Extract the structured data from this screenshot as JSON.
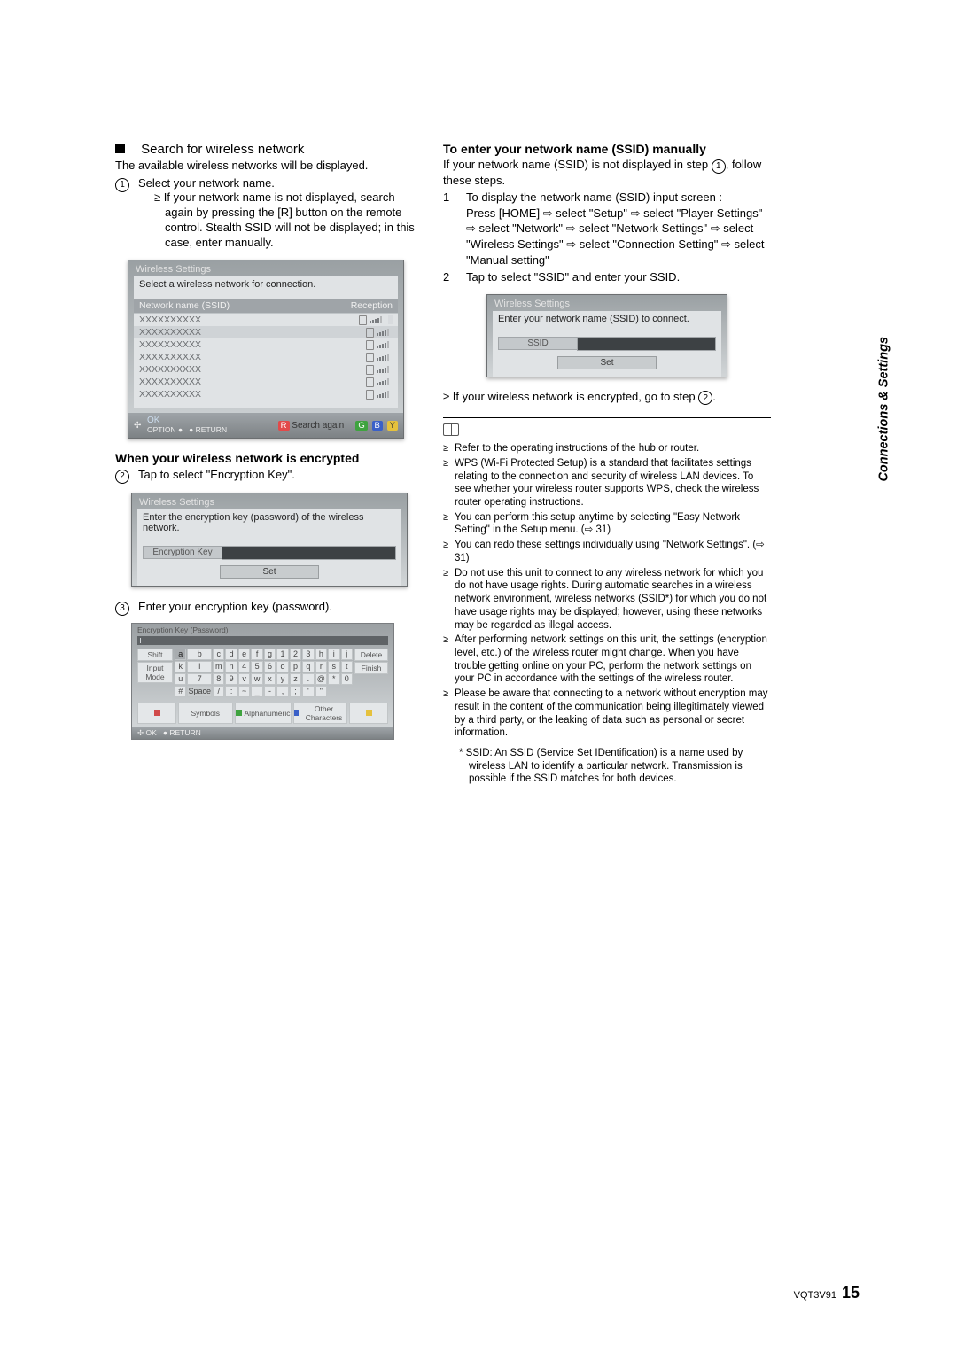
{
  "left": {
    "heading": "Search for wireless network",
    "intro": "The available wireless networks will be displayed.",
    "step1_label": "1",
    "step1_text": "Select your network name.",
    "step1_bullet": "If your network name is not displayed, search again by pressing the [R] button on the remote control. Stealth SSID will not be displayed; in this case, enter manually.",
    "panel_net": {
      "title": "Wireless Settings",
      "prompt": "Select a wireless network for connection.",
      "col_a": "Network name (SSID)",
      "col_b": "Reception",
      "ssid": "XXXXXXXXXX",
      "footer_ok": "OK",
      "footer_option": "OPTION",
      "footer_return": "RETURN",
      "footer_search": "Search again",
      "r": "R",
      "g": "G",
      "b": "B",
      "y": "Y"
    },
    "encrypted_heading": "When your wireless network is encrypted",
    "step2_label": "2",
    "step2_text": "Tap to select \"Encryption Key\".",
    "panel_ek": {
      "title": "Wireless Settings",
      "prompt": "Enter the encryption key (password) of the wireless network.",
      "label": "Encryption Key",
      "set": "Set"
    },
    "step3_label": "3",
    "step3_text": "Enter your encryption key (password).",
    "kb": {
      "title": "Encryption Key (Password)",
      "shift": "Shift",
      "inputmode": "Input Mode",
      "delete": "Delete",
      "finish": "Finish",
      "space": "Space",
      "symbols": "Symbols",
      "alpha": "Alphanumeric",
      "other": "Other Characters",
      "ok": "OK",
      "return": "RETURN",
      "keys": [
        "a",
        "b",
        "c",
        "d",
        "e",
        "f",
        "g",
        "1",
        "2",
        "3",
        "h",
        "i",
        "j",
        "k",
        "l",
        "m",
        "n",
        "4",
        "5",
        "6",
        "o",
        "p",
        "q",
        "r",
        "s",
        "t",
        "u",
        "7",
        "8",
        "9",
        "v",
        "w",
        "x",
        "y",
        "z",
        ".",
        "@",
        "*",
        "0",
        "#",
        "",
        "/",
        ":",
        "~",
        "_",
        "-",
        ",",
        ";",
        "'",
        "\""
      ]
    }
  },
  "right": {
    "heading": "To enter your network name (SSID) manually",
    "intro_a": "If your network name (SSID) is not displayed in step ",
    "intro_b": ", follow these steps.",
    "step1_num": "1",
    "step1_text": "To display the network name (SSID) input screen :",
    "step1_path": "Press [HOME] ⇨ select \"Setup\" ⇨ select \"Player Settings\" ⇨ select \"Network\" ⇨ select \"Network Settings\" ⇨ select \"Wireless Settings\" ⇨ select \"Connection Setting\" ⇨ select \"Manual setting\"",
    "step2_num": "2",
    "step2_text": "Tap to select \"SSID\" and enter your SSID.",
    "panel_ssid": {
      "title": "Wireless Settings",
      "prompt": "Enter your network name (SSID) to connect.",
      "label": "SSID",
      "set": "Set"
    },
    "enc_note_a": "If your wireless network is encrypted, go to step ",
    "enc_note_b": ".",
    "notes": [
      "Refer to the operating instructions of the hub or router.",
      "WPS (Wi-Fi Protected Setup) is a standard that facilitates settings relating to the connection and security of wireless LAN devices. To see whether your wireless router supports WPS, check the wireless router operating instructions.",
      "You can perform this setup anytime by selecting \"Easy Network Setting\" in the Setup menu. (⇨ 31)",
      "You can redo these settings individually using \"Network Settings\". (⇨ 31)",
      "Do not use this unit to connect to any wireless network for which you do not have usage rights.\nDuring automatic searches in a wireless network environment, wireless networks (SSID*) for which you do not have usage rights may be displayed; however, using these networks may be regarded as illegal access.",
      "After performing network settings on this unit, the settings (encryption level, etc.) of the wireless router might change. When you have trouble getting online on your PC, perform the network settings on your PC in accordance with the settings of the wireless router.",
      "Please be aware that connecting to a network without encryption may result in the content of the communication being illegitimately viewed by a third party, or the leaking of data such as personal or secret information."
    ],
    "footnote": "* SSID:\nAn SSID (Service Set IDentification) is a name used by wireless LAN to identify a particular network. Transmission is possible if the SSID matches for both devices."
  },
  "side_tab": "Connections & Settings",
  "footer_code": "VQT3V91",
  "footer_page": "15"
}
